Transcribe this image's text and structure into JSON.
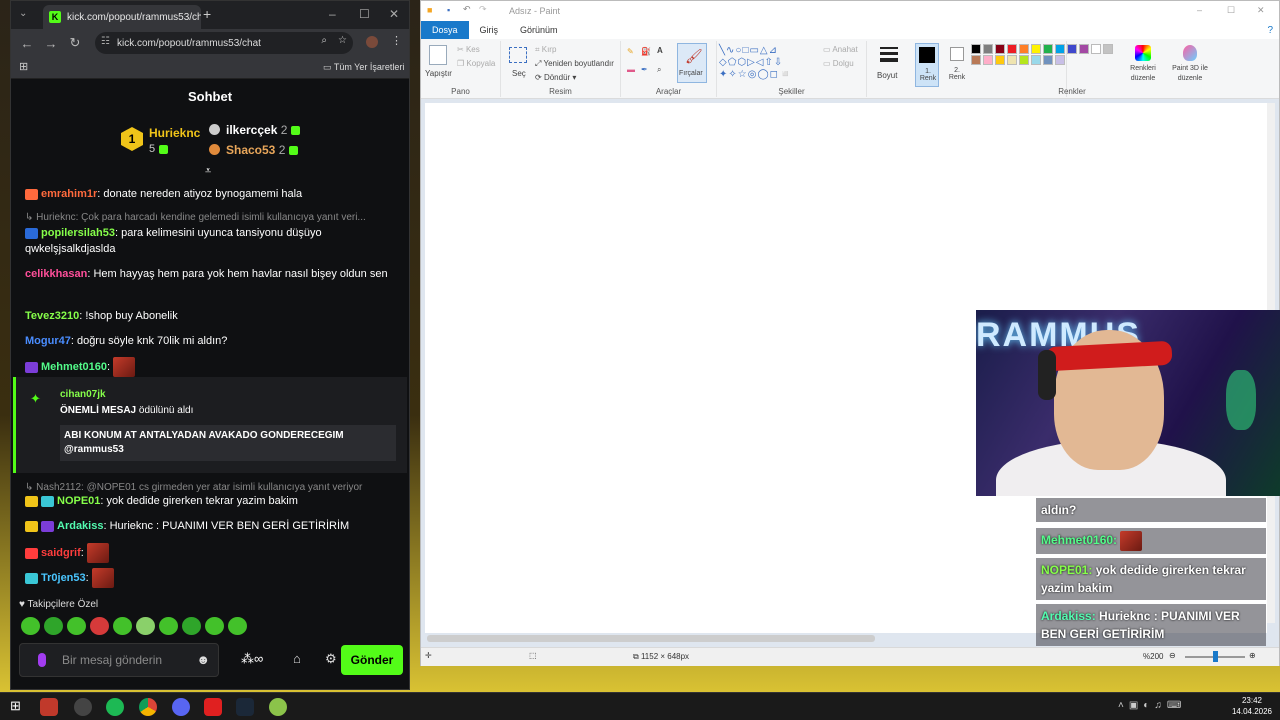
{
  "browser": {
    "tab_title": "kick.com/popout/rammus53/ch",
    "url": "kick.com/popout/rammus53/chat",
    "bookmarks_label": "Tüm Yer İşaretleri"
  },
  "chat": {
    "header": "Sohbet",
    "leaderboard": {
      "top": {
        "rank": "1",
        "name": "Hurieknc",
        "count": "5"
      },
      "second": {
        "name": "ilkercçek",
        "count": "2"
      },
      "third": {
        "name": "Shaco53",
        "count": "2"
      }
    },
    "messages": [
      {
        "user": "emrahim1r",
        "text": ": donate nereden atiyoz bynogamemi hala",
        "color": "#ff6a3d"
      },
      {
        "reply": "Hurieknc: Çok para harcadı kendine gelemedi isimli kullanıcıya yanıt veri..."
      },
      {
        "user": "popilersilah53",
        "text": ": para kelimesini uyunca tansiyonu düşüyo qwkelşjsalkdjaslda",
        "color": "#86ff4a"
      },
      {
        "user": "celikkhasan",
        "text": ": Hem hayyaş hem para yok hem havlar nasıl bişey oldun sen",
        "color": "#ff4f9a"
      },
      {
        "user": "Tevez3210",
        "text": ": !shop buy Abonelik",
        "color": "#86ff4a"
      },
      {
        "user": "Mogur47",
        "text": ": doğru söyle knk 70lik mi aldın?",
        "color": "#4a8dff"
      },
      {
        "user": "Mehmet0160",
        "text": ":",
        "color": "#53fc8a"
      }
    ],
    "pinned": {
      "user": "cihan07jk",
      "reward": "ÖNEMLİ MESAJ",
      "reward_suffix": " ödülünü aldı",
      "quote": "ABI KONUM AT ANTALYADAN AVAKADO GONDERECEGIM @rammus53"
    },
    "messages2": [
      {
        "reply": "Nash2112: @NOPE01 cs girmeden yer atar isimli kullanıcıya yanıt veriyor"
      },
      {
        "user": "NOPE01",
        "text": ": yok dedide girerken tekrar yazim bakim",
        "color": "#86ff4a"
      },
      {
        "user": "Ardakiss",
        "text": ": Hurieknc : PUANIMI VER BEN GERİ GETİRİRİM",
        "color": "#53fcb0"
      },
      {
        "user": "saidgrif",
        "text": ":",
        "color": "#ff3d3d"
      },
      {
        "user": "Tr0jen53",
        "text": ":",
        "color": "#4ac6ff"
      }
    ],
    "followers_only": "Takipçilere Özel",
    "input_placeholder": "Bir mesaj gönderin",
    "send_label": "Gönder"
  },
  "paint": {
    "title": "Adsız - Paint",
    "tabs": [
      "Dosya",
      "Giriş",
      "Görünüm"
    ],
    "ribbon": {
      "paste": "Yapıştır",
      "cut": "Kes",
      "copy": "Kopyala",
      "select": "Seç",
      "crop": "Kırp",
      "resize": "Yeniden boyutlandır",
      "rotate": "Döndür",
      "brushes": "Fırçalar",
      "outline": "Anahat",
      "fill": "Dolgu",
      "size": "Boyut",
      "color1": "1. Renk",
      "color2": "2. Renk",
      "edit_colors": "Renkleri düzenle",
      "paint3d": "Paint 3D ile düzenle",
      "groups": {
        "clipboard": "Pano",
        "image": "Resim",
        "tools": "Araçlar",
        "shapes": "Şekiller",
        "colors": "Renkler"
      }
    },
    "palette": [
      "#000000",
      "#7f7f7f",
      "#880015",
      "#ed1c24",
      "#ff7f27",
      "#fff200",
      "#22b14c",
      "#00a2e8",
      "#3f48cc",
      "#a349a4",
      "#ffffff",
      "#c3c3c3",
      "#b97a57",
      "#ffaec9",
      "#ffc90e",
      "#efe4b0",
      "#b5e61d",
      "#99d9ea",
      "#7092be",
      "#c8bfe7"
    ],
    "canvas_size": "1152 × 648px",
    "zoom": "%200"
  },
  "webcam": {
    "text": "RAMMUS"
  },
  "overlay": [
    {
      "text": "aldın?"
    },
    {
      "user": "Mehmet0160:",
      "text": ""
    },
    {
      "user": "NOPE01:",
      "text": " yok dedide girerken tekrar yazim bakim"
    },
    {
      "user": "Ardakiss:",
      "text": " Hurieknc : PUANIMI VER BEN GERİ GETİRİRİM"
    }
  ],
  "taskbar": {
    "time": "23:42",
    "date": "14.04.2026"
  }
}
